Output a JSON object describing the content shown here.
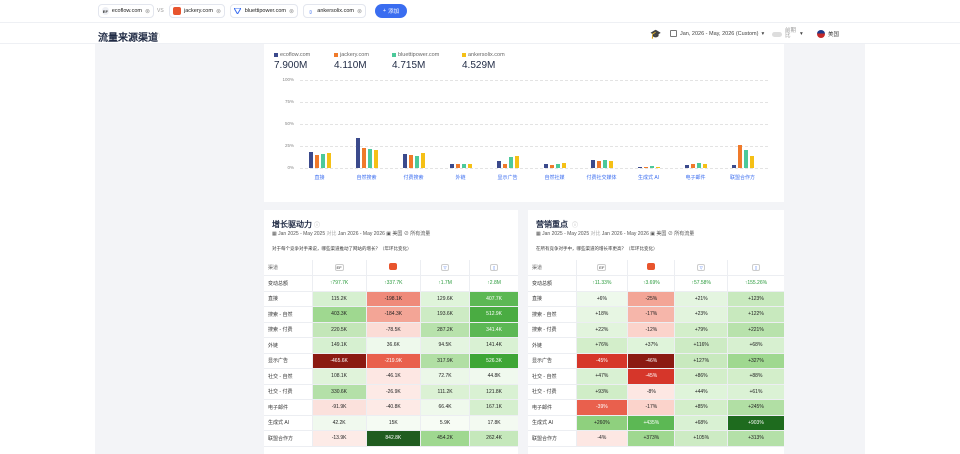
{
  "top": {
    "competitors": [
      {
        "favicon": "EF",
        "domain": "ecoflow.com",
        "dot": "#3b4a8c"
      },
      {
        "favicon": "",
        "domain": "jackery.com",
        "dot": "#f59a23"
      },
      {
        "favicon": "",
        "domain": "bluettipower.com",
        "dot": "#4cc99a"
      },
      {
        "favicon": "",
        "domain": "ankersolix.com",
        "dot": "#f5b800"
      }
    ],
    "vs": "VS",
    "add_label": "添加"
  },
  "header": {
    "title": "流量来源渠道",
    "date_range": "Jan, 2026 - May, 2026 (Custom)",
    "compare_label": "前期比",
    "country": "美国"
  },
  "colors": {
    "ecoflow": "#3b4a8c",
    "jackery": "#f07a2a",
    "bluetti": "#4cc99a",
    "anker": "#f5c016",
    "accent": "#3a6df0"
  },
  "chart_data": {
    "type": "bar",
    "legend": [
      {
        "name": "ecoflow.com",
        "total": "7.900M"
      },
      {
        "name": "jackery.com",
        "total": "4.110M"
      },
      {
        "name": "bluettipower.com",
        "total": "4.715M"
      },
      {
        "name": "ankersolix.com",
        "total": "4.529M"
      }
    ],
    "yticks": [
      "100%",
      "75%",
      "50%",
      "25%",
      "0%"
    ],
    "ylim": [
      0,
      100
    ],
    "categories": [
      "直接",
      "自然搜索",
      "付费搜索",
      "外链",
      "显示广告",
      "自然社媒",
      "付费社交媒体",
      "生成式 AI",
      "电子邮件",
      "联盟合作方"
    ],
    "series": [
      {
        "name": "ecoflow.com",
        "values": [
          18,
          34,
          16,
          4,
          8,
          4,
          9,
          1,
          3,
          3
        ]
      },
      {
        "name": "jackery.com",
        "values": [
          15,
          23,
          15,
          4,
          5,
          3,
          8,
          1,
          5,
          26
        ]
      },
      {
        "name": "bluettipower.com",
        "values": [
          16,
          22,
          14,
          4,
          12,
          4,
          9,
          2,
          6,
          20
        ]
      },
      {
        "name": "ankersolix.com",
        "values": [
          17,
          20,
          17,
          5,
          14,
          6,
          8,
          1,
          5,
          14
        ]
      }
    ]
  },
  "growth": {
    "title": "增长驱动力",
    "filters": [
      "Jan 2025 - May 2025",
      "对比",
      "Jan 2026 - May 2026",
      "美国",
      "所有流量"
    ],
    "question": "对于每个竞争对手来说，哪些渠道推动了网站的增长？（年环比变化）",
    "col_header": "渠道",
    "rows": [
      {
        "label": "变动总额",
        "cells": [
          "↑797.7K",
          "↑337.7K",
          "↑1.7M",
          "↑2.8M"
        ]
      },
      {
        "label": "直接",
        "cells": [
          "115.2K",
          "-198.1K",
          "129.6K",
          "407.7K"
        ]
      },
      {
        "label": "搜索 - 自然",
        "cells": [
          "403.3K",
          "-184.3K",
          "193.6K",
          "512.9K"
        ]
      },
      {
        "label": "搜索 - 付费",
        "cells": [
          "220.5K",
          "-78.5K",
          "287.2K",
          "341.4K"
        ]
      },
      {
        "label": "外链",
        "cells": [
          "149.1K",
          "36.6K",
          "94.5K",
          "141.4K"
        ]
      },
      {
        "label": "显示广告",
        "cells": [
          "-465.6K",
          "-219.9K",
          "317.9K",
          "526.3K"
        ]
      },
      {
        "label": "社交 - 自然",
        "cells": [
          "108.1K",
          "-46.1K",
          "72.7K",
          "44.8K"
        ]
      },
      {
        "label": "社交 - 付费",
        "cells": [
          "330.6K",
          "-26.9K",
          "111.2K",
          "121.8K"
        ]
      },
      {
        "label": "电子邮件",
        "cells": [
          "-91.9K",
          "-40.8K",
          "66.4K",
          "167.1K"
        ]
      },
      {
        "label": "生成式 AI",
        "cells": [
          "42.2K",
          "15K",
          "5.9K",
          "17.8K"
        ]
      },
      {
        "label": "联盟合作方",
        "cells": [
          "-13.9K",
          "842.8K",
          "454.2K",
          "262.4K"
        ]
      }
    ],
    "colors": [
      [
        "#fff",
        "#fff",
        "#fff",
        "#fff"
      ],
      [
        "#d6f0d0",
        "#ef8a7a",
        "#dff4da",
        "#5cb854"
      ],
      [
        "#9fd890",
        "#f3a596",
        "#cdebc4",
        "#4aac42"
      ],
      [
        "#c3e6b8",
        "#fbdcd6",
        "#b8e2ac",
        "#5cb854"
      ],
      [
        "#d6f0d0",
        "#eef9ec",
        "#e4f5e0",
        "#d9f1d3"
      ],
      [
        "#8b1a12",
        "#e9604d",
        "#b1dfa4",
        "#3ea636"
      ],
      [
        "#e0f3da",
        "#fde7e3",
        "#ebf7e8",
        "#f0f9ee"
      ],
      [
        "#b4e0a8",
        "#fdeae6",
        "#dbf1d4",
        "#d9f1d3"
      ],
      [
        "#fbe1dc",
        "#fdeae6",
        "#eff9ec",
        "#d5efce"
      ],
      [
        "#f0f9ee",
        "#f5fbf3",
        "#f7fcf5",
        "#f3faf1"
      ],
      [
        "#fdebe7",
        "#205c20",
        "#9fd890",
        "#c5e8bb"
      ]
    ]
  },
  "marketing": {
    "title": "营销重点",
    "filters": [
      "Jan 2025 - May 2025",
      "对比",
      "Jan 2026 - May 2026",
      "美国",
      "所有流量"
    ],
    "question": "在所有竞争对手中，哪些渠道的增长率更高？（年环比变化）",
    "col_header": "渠道",
    "rows": [
      {
        "label": "变动总额",
        "cells": [
          "↑11.33%",
          "↑3.69%",
          "↑57.58%",
          "↑155.26%"
        ]
      },
      {
        "label": "直接",
        "cells": [
          "+6%",
          "-25%",
          "+21%",
          "+123%"
        ]
      },
      {
        "label": "搜索 - 自然",
        "cells": [
          "+18%",
          "-17%",
          "+23%",
          "+122%"
        ]
      },
      {
        "label": "搜索 - 付费",
        "cells": [
          "+22%",
          "-12%",
          "+79%",
          "+221%"
        ]
      },
      {
        "label": "外链",
        "cells": [
          "+76%",
          "+37%",
          "+116%",
          "+68%"
        ]
      },
      {
        "label": "显示广告",
        "cells": [
          "-45%",
          "-46%",
          "+127%",
          "+327%"
        ]
      },
      {
        "label": "社交 - 自然",
        "cells": [
          "+47%",
          "-45%",
          "+86%",
          "+88%"
        ]
      },
      {
        "label": "社交 - 付费",
        "cells": [
          "+93%",
          "-8%",
          "+44%",
          "+61%"
        ]
      },
      {
        "label": "电子邮件",
        "cells": [
          "-39%",
          "-17%",
          "+85%",
          "+245%"
        ]
      },
      {
        "label": "生成式 AI",
        "cells": [
          "+260%",
          "+435%",
          "+68%",
          "+903%"
        ]
      },
      {
        "label": "联盟合作方",
        "cells": [
          "-4%",
          "+373%",
          "+105%",
          "+313%"
        ]
      }
    ],
    "colors": [
      [
        "#fff",
        "#fff",
        "#fff",
        "#fff"
      ],
      [
        "#eef9ec",
        "#f3a596",
        "#e4f5e0",
        "#c8e9be"
      ],
      [
        "#e7f6e3",
        "#f6b6aa",
        "#e2f4dd",
        "#c8e9be"
      ],
      [
        "#e2f4dd",
        "#fbd3cb",
        "#d3eeca",
        "#b8e2ac"
      ],
      [
        "#d3eeca",
        "#dff4da",
        "#cdebc4",
        "#d7f0d0"
      ],
      [
        "#d6362a",
        "#8b1a12",
        "#c8e9be",
        "#9fd890"
      ],
      [
        "#d9f1d3",
        "#d6362a",
        "#d3eeca",
        "#d3eeca"
      ],
      [
        "#d0edc7",
        "#fde7e3",
        "#dff4da",
        "#dbf2d5"
      ],
      [
        "#e9604d",
        "#fbd3cb",
        "#d3eeca",
        "#b1dfa4"
      ],
      [
        "#8fd07e",
        "#5cb854",
        "#d9f1d3",
        "#1e6b1e"
      ],
      [
        "#fde7e3",
        "#9fd890",
        "#cdebc4",
        "#b4e0a8"
      ]
    ]
  }
}
